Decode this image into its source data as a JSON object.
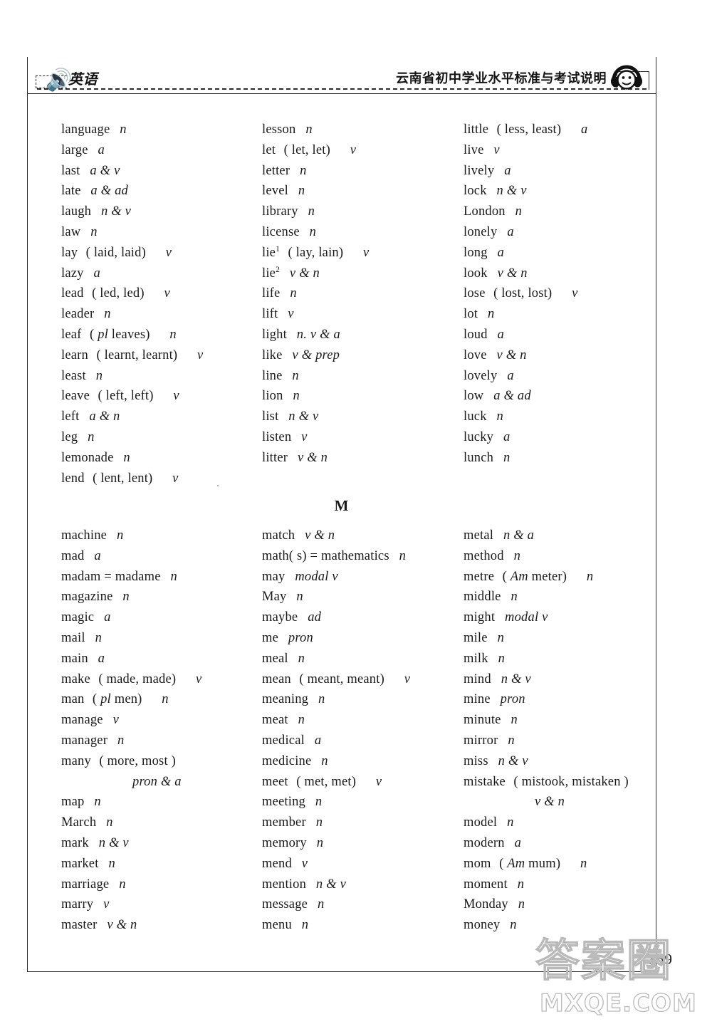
{
  "header": {
    "left_label": "英语",
    "left_icon": "speaker-icon",
    "title": "云南省初中学业水平标准与考试说明",
    "right_icon": "headphones-smiley-icon"
  },
  "footer": {
    "page_number": "159"
  },
  "watermark": {
    "cn": "答案圈",
    "en": "MXQE.COM"
  },
  "sections": [
    {
      "letter": "",
      "columns": [
        {
          "entries": [
            {
              "word": "language",
              "pos": "n"
            },
            {
              "word": "large",
              "pos": "a"
            },
            {
              "word": "last",
              "pos": "a & v"
            },
            {
              "word": "late",
              "pos": "a & ad"
            },
            {
              "word": "laugh",
              "pos": "n & v"
            },
            {
              "word": "law",
              "pos": "n"
            },
            {
              "word": "lay",
              "forms": "( laid, laid)",
              "pos": "v"
            },
            {
              "word": "lazy",
              "pos": "a"
            },
            {
              "word": "lead",
              "forms": "( led, led)",
              "pos": "v"
            },
            {
              "word": "leader",
              "pos": "n"
            },
            {
              "word": "leaf",
              "forms": "( pl leaves)",
              "forms_italic": "pl",
              "pos": "n"
            },
            {
              "word": "learn",
              "forms": "( learnt, learnt)",
              "pos": "v"
            },
            {
              "word": "least",
              "pos": "n"
            },
            {
              "word": "leave",
              "forms": "( left, left)",
              "pos": "v"
            },
            {
              "word": "left",
              "pos": "a & n"
            },
            {
              "word": "leg",
              "pos": "n"
            },
            {
              "word": "lemonade",
              "pos": "n"
            },
            {
              "word": "lend",
              "forms": "( lent, lent)",
              "pos": "v"
            }
          ]
        },
        {
          "entries": [
            {
              "word": "lesson",
              "pos": "n"
            },
            {
              "word": "let",
              "forms": "( let, let)",
              "pos": "v"
            },
            {
              "word": "letter",
              "pos": "n"
            },
            {
              "word": "level",
              "pos": "n"
            },
            {
              "word": "library",
              "pos": "n"
            },
            {
              "word": "license",
              "pos": "n"
            },
            {
              "word": "lie",
              "sup": "1",
              "forms": "( lay, lain)",
              "pos": "v"
            },
            {
              "word": "lie",
              "sup": "2",
              "pos": "v & n"
            },
            {
              "word": "life",
              "pos": "n"
            },
            {
              "word": "lift",
              "pos": "v"
            },
            {
              "word": "light",
              "pos": "n. v & a"
            },
            {
              "word": "like",
              "pos": "v & prep"
            },
            {
              "word": "line",
              "pos": "n"
            },
            {
              "word": "lion",
              "pos": "n"
            },
            {
              "word": "list",
              "pos": "n & v"
            },
            {
              "word": "listen",
              "pos": "v"
            },
            {
              "word": "litter",
              "pos": "v & n"
            }
          ]
        },
        {
          "entries": [
            {
              "word": "little",
              "forms": "( less, least)",
              "pos": "a"
            },
            {
              "word": "live",
              "pos": "v"
            },
            {
              "word": "lively",
              "pos": "a"
            },
            {
              "word": "lock",
              "pos": "n & v"
            },
            {
              "word": "London",
              "pos": "n"
            },
            {
              "word": "lonely",
              "pos": "a"
            },
            {
              "word": "long",
              "pos": "a"
            },
            {
              "word": "look",
              "pos": "v & n"
            },
            {
              "word": "lose",
              "forms": "( lost, lost)",
              "pos": "v"
            },
            {
              "word": "lot",
              "pos": "n"
            },
            {
              "word": "loud",
              "pos": "a"
            },
            {
              "word": "love",
              "pos": "v & n"
            },
            {
              "word": "lovely",
              "pos": "a"
            },
            {
              "word": "low",
              "pos": "a & ad"
            },
            {
              "word": "luck",
              "pos": "n"
            },
            {
              "word": "lucky",
              "pos": "a"
            },
            {
              "word": "lunch",
              "pos": "n"
            }
          ]
        }
      ]
    },
    {
      "letter": "M",
      "columns": [
        {
          "entries": [
            {
              "word": "machine",
              "pos": "n"
            },
            {
              "word": "mad",
              "pos": "a"
            },
            {
              "word": "madam = madame",
              "pos": "n"
            },
            {
              "word": "magazine",
              "pos": "n"
            },
            {
              "word": "magic",
              "pos": "a"
            },
            {
              "word": "mail",
              "pos": "n"
            },
            {
              "word": "main",
              "pos": "a"
            },
            {
              "word": "make",
              "forms": "( made, made)",
              "pos": "v"
            },
            {
              "word": "man",
              "forms": "( pl men)",
              "forms_italic": "pl",
              "pos": "n"
            },
            {
              "word": "manage",
              "pos": "v"
            },
            {
              "word": "manager",
              "pos": "n"
            },
            {
              "word": "many",
              "forms": "( more, most )"
            },
            {
              "continuation": "pron & a",
              "indent": "wide"
            },
            {
              "word": "map",
              "pos": "n"
            },
            {
              "word": "March",
              "pos": "n"
            },
            {
              "word": "mark",
              "pos": "n & v"
            },
            {
              "word": "market",
              "pos": "n"
            },
            {
              "word": "marriage",
              "pos": "n"
            },
            {
              "word": "marry",
              "pos": "v"
            },
            {
              "word": "master",
              "pos": "v & n"
            }
          ]
        },
        {
          "entries": [
            {
              "word": "match",
              "pos": "v & n"
            },
            {
              "word": "math( s) = mathematics",
              "pos": "n"
            },
            {
              "word": "may",
              "pos": "modal v"
            },
            {
              "word": "May",
              "pos": "n"
            },
            {
              "word": "maybe",
              "pos": "ad"
            },
            {
              "word": "me",
              "pos": "pron"
            },
            {
              "word": "meal",
              "pos": "n"
            },
            {
              "word": "mean",
              "forms": "( meant, meant)",
              "pos": "v"
            },
            {
              "word": "meaning",
              "pos": "n"
            },
            {
              "word": "meat",
              "pos": "n"
            },
            {
              "word": "medical",
              "pos": "a"
            },
            {
              "word": "medicine",
              "pos": "n"
            },
            {
              "word": "meet",
              "forms": "( met, met)",
              "pos": "v"
            },
            {
              "word": "meeting",
              "pos": "n"
            },
            {
              "word": "member",
              "pos": "n"
            },
            {
              "word": "memory",
              "pos": "n"
            },
            {
              "word": "mend",
              "pos": "v"
            },
            {
              "word": "mention",
              "pos": "n & v"
            },
            {
              "word": "message",
              "pos": "n"
            },
            {
              "word": "menu",
              "pos": "n"
            }
          ]
        },
        {
          "entries": [
            {
              "word": "metal",
              "pos": "n & a"
            },
            {
              "word": "method",
              "pos": "n"
            },
            {
              "word": "metre",
              "forms": "( Am meter)",
              "forms_italic": "Am",
              "pos": "n"
            },
            {
              "word": "middle",
              "pos": "n"
            },
            {
              "word": "might",
              "pos": "modal v"
            },
            {
              "word": "mile",
              "pos": "n"
            },
            {
              "word": "milk",
              "pos": "n"
            },
            {
              "word": "mind",
              "pos": "n & v"
            },
            {
              "word": "mine",
              "pos": "pron"
            },
            {
              "word": "minute",
              "pos": "n"
            },
            {
              "word": "mirror",
              "pos": "n"
            },
            {
              "word": "miss",
              "pos": "n & v"
            },
            {
              "word": "mistake",
              "forms": "( mistook, mistaken )"
            },
            {
              "continuation": "v & n",
              "indent": "wide"
            },
            {
              "word": "model",
              "pos": "n"
            },
            {
              "word": "modern",
              "pos": "a"
            },
            {
              "word": "mom",
              "forms": "( Am mum)",
              "forms_italic": "Am",
              "pos": "n"
            },
            {
              "word": "moment",
              "pos": "n"
            },
            {
              "word": "Monday",
              "pos": "n"
            },
            {
              "word": "money",
              "pos": "n"
            }
          ]
        }
      ]
    }
  ]
}
